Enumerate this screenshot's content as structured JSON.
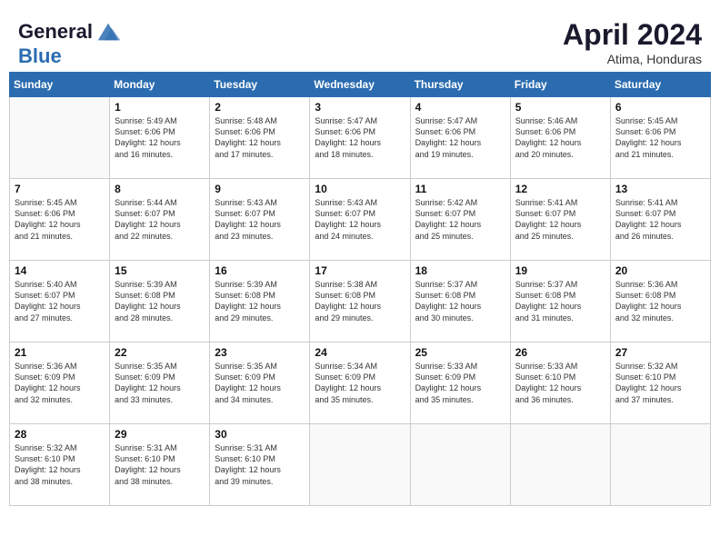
{
  "header": {
    "logo_line1": "General",
    "logo_line2": "Blue",
    "month": "April 2024",
    "location": "Atima, Honduras"
  },
  "days_of_week": [
    "Sunday",
    "Monday",
    "Tuesday",
    "Wednesday",
    "Thursday",
    "Friday",
    "Saturday"
  ],
  "weeks": [
    [
      {
        "day": "",
        "empty": true
      },
      {
        "day": "1",
        "sunrise": "5:49 AM",
        "sunset": "6:06 PM",
        "daylight": "12 hours and 16 minutes."
      },
      {
        "day": "2",
        "sunrise": "5:48 AM",
        "sunset": "6:06 PM",
        "daylight": "12 hours and 17 minutes."
      },
      {
        "day": "3",
        "sunrise": "5:47 AM",
        "sunset": "6:06 PM",
        "daylight": "12 hours and 18 minutes."
      },
      {
        "day": "4",
        "sunrise": "5:47 AM",
        "sunset": "6:06 PM",
        "daylight": "12 hours and 19 minutes."
      },
      {
        "day": "5",
        "sunrise": "5:46 AM",
        "sunset": "6:06 PM",
        "daylight": "12 hours and 20 minutes."
      },
      {
        "day": "6",
        "sunrise": "5:45 AM",
        "sunset": "6:06 PM",
        "daylight": "12 hours and 21 minutes."
      }
    ],
    [
      {
        "day": "7",
        "sunrise": "5:45 AM",
        "sunset": "6:06 PM",
        "daylight": "12 hours and 21 minutes."
      },
      {
        "day": "8",
        "sunrise": "5:44 AM",
        "sunset": "6:07 PM",
        "daylight": "12 hours and 22 minutes."
      },
      {
        "day": "9",
        "sunrise": "5:43 AM",
        "sunset": "6:07 PM",
        "daylight": "12 hours and 23 minutes."
      },
      {
        "day": "10",
        "sunrise": "5:43 AM",
        "sunset": "6:07 PM",
        "daylight": "12 hours and 24 minutes."
      },
      {
        "day": "11",
        "sunrise": "5:42 AM",
        "sunset": "6:07 PM",
        "daylight": "12 hours and 25 minutes."
      },
      {
        "day": "12",
        "sunrise": "5:41 AM",
        "sunset": "6:07 PM",
        "daylight": "12 hours and 25 minutes."
      },
      {
        "day": "13",
        "sunrise": "5:41 AM",
        "sunset": "6:07 PM",
        "daylight": "12 hours and 26 minutes."
      }
    ],
    [
      {
        "day": "14",
        "sunrise": "5:40 AM",
        "sunset": "6:07 PM",
        "daylight": "12 hours and 27 minutes."
      },
      {
        "day": "15",
        "sunrise": "5:39 AM",
        "sunset": "6:08 PM",
        "daylight": "12 hours and 28 minutes."
      },
      {
        "day": "16",
        "sunrise": "5:39 AM",
        "sunset": "6:08 PM",
        "daylight": "12 hours and 29 minutes."
      },
      {
        "day": "17",
        "sunrise": "5:38 AM",
        "sunset": "6:08 PM",
        "daylight": "12 hours and 29 minutes."
      },
      {
        "day": "18",
        "sunrise": "5:37 AM",
        "sunset": "6:08 PM",
        "daylight": "12 hours and 30 minutes."
      },
      {
        "day": "19",
        "sunrise": "5:37 AM",
        "sunset": "6:08 PM",
        "daylight": "12 hours and 31 minutes."
      },
      {
        "day": "20",
        "sunrise": "5:36 AM",
        "sunset": "6:08 PM",
        "daylight": "12 hours and 32 minutes."
      }
    ],
    [
      {
        "day": "21",
        "sunrise": "5:36 AM",
        "sunset": "6:09 PM",
        "daylight": "12 hours and 32 minutes."
      },
      {
        "day": "22",
        "sunrise": "5:35 AM",
        "sunset": "6:09 PM",
        "daylight": "12 hours and 33 minutes."
      },
      {
        "day": "23",
        "sunrise": "5:35 AM",
        "sunset": "6:09 PM",
        "daylight": "12 hours and 34 minutes."
      },
      {
        "day": "24",
        "sunrise": "5:34 AM",
        "sunset": "6:09 PM",
        "daylight": "12 hours and 35 minutes."
      },
      {
        "day": "25",
        "sunrise": "5:33 AM",
        "sunset": "6:09 PM",
        "daylight": "12 hours and 35 minutes."
      },
      {
        "day": "26",
        "sunrise": "5:33 AM",
        "sunset": "6:10 PM",
        "daylight": "12 hours and 36 minutes."
      },
      {
        "day": "27",
        "sunrise": "5:32 AM",
        "sunset": "6:10 PM",
        "daylight": "12 hours and 37 minutes."
      }
    ],
    [
      {
        "day": "28",
        "sunrise": "5:32 AM",
        "sunset": "6:10 PM",
        "daylight": "12 hours and 38 minutes."
      },
      {
        "day": "29",
        "sunrise": "5:31 AM",
        "sunset": "6:10 PM",
        "daylight": "12 hours and 38 minutes."
      },
      {
        "day": "30",
        "sunrise": "5:31 AM",
        "sunset": "6:10 PM",
        "daylight": "12 hours and 39 minutes."
      },
      {
        "day": "",
        "empty": true
      },
      {
        "day": "",
        "empty": true
      },
      {
        "day": "",
        "empty": true
      },
      {
        "day": "",
        "empty": true
      }
    ]
  ]
}
